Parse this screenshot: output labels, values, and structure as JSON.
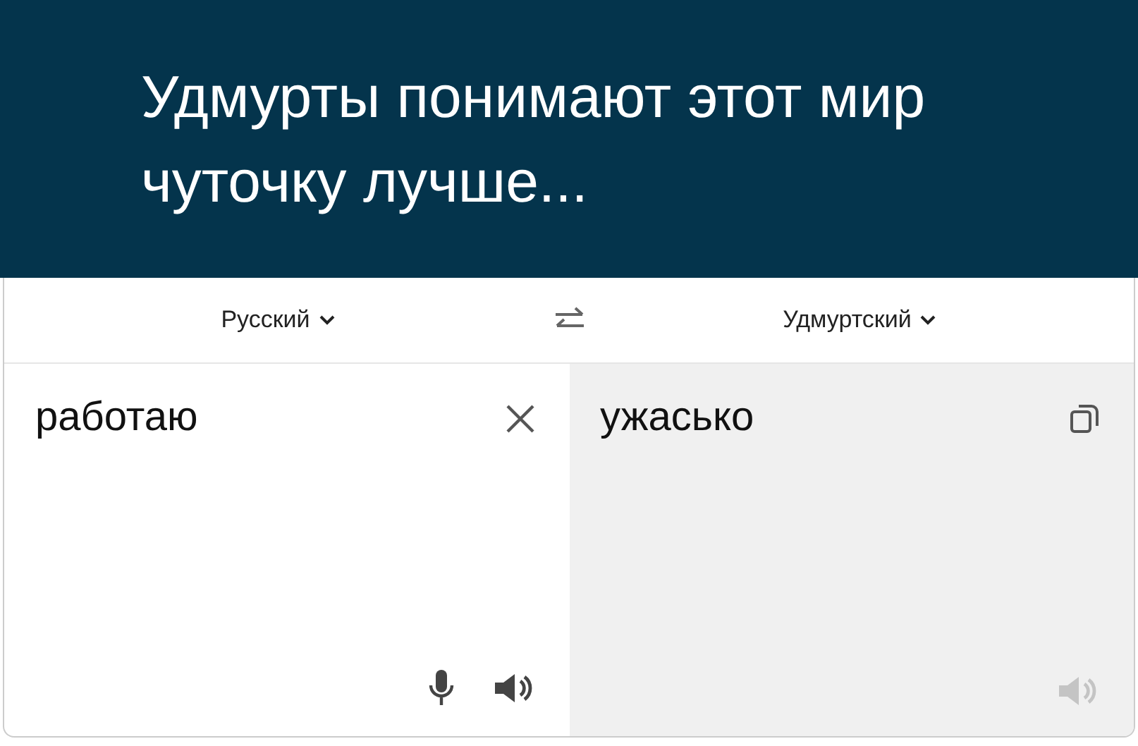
{
  "banner": {
    "title": "Удмурты понимают этот мир чуточку лучше..."
  },
  "translator": {
    "source_language": "Русский",
    "target_language": "Удмуртский",
    "source_text": "работаю",
    "translation": "ужасько"
  }
}
